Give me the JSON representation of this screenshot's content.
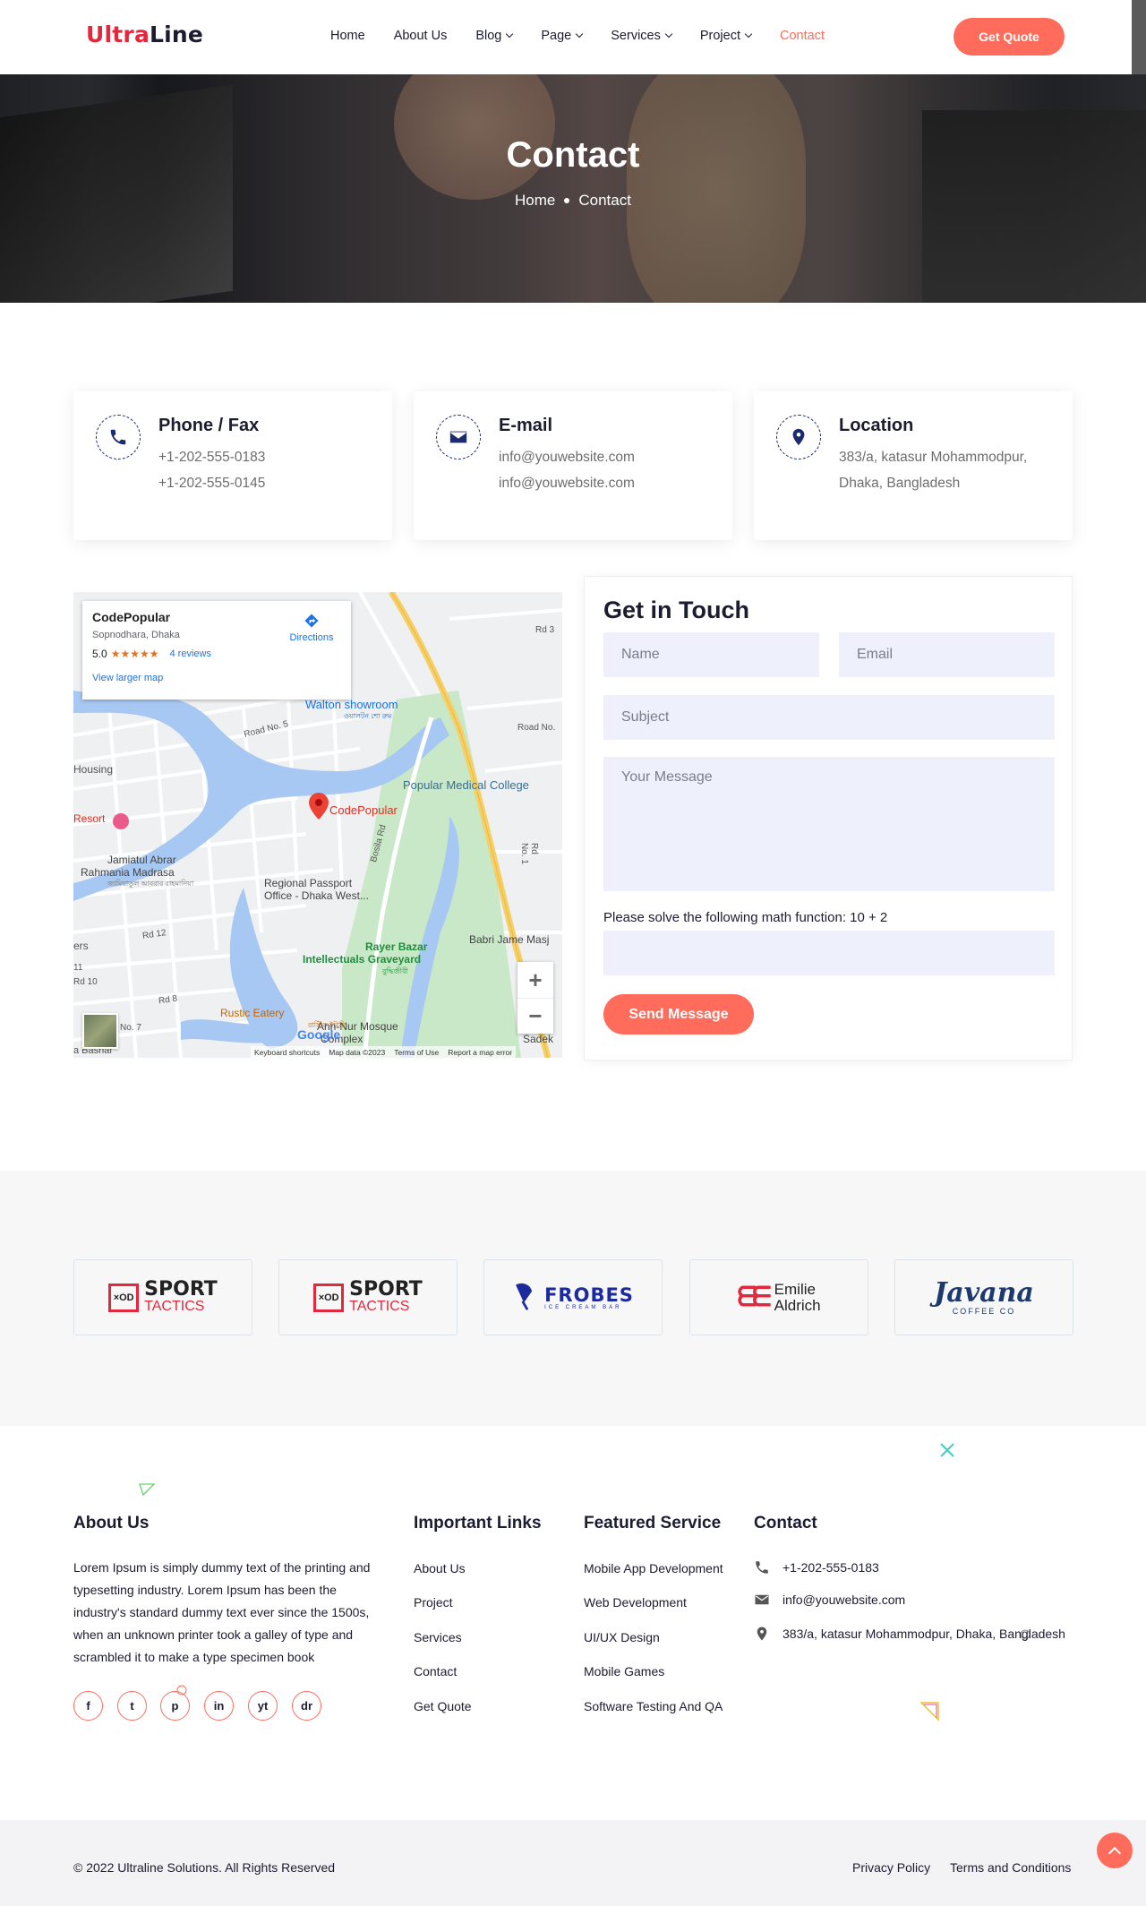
{
  "header": {
    "logo_part1": "Ultra",
    "logo_part2": "Line",
    "nav": [
      {
        "label": "Home",
        "dropdown": false
      },
      {
        "label": "About Us",
        "dropdown": false
      },
      {
        "label": "Blog",
        "dropdown": true
      },
      {
        "label": "Page",
        "dropdown": true
      },
      {
        "label": "Services",
        "dropdown": true
      },
      {
        "label": "Project",
        "dropdown": true
      },
      {
        "label": "Contact",
        "dropdown": false,
        "active": true
      }
    ],
    "quote_button": "Get Quote"
  },
  "hero": {
    "title": "Contact",
    "breadcrumb_home": "Home",
    "breadcrumb_current": "Contact"
  },
  "info_cards": [
    {
      "icon": "phone-icon",
      "title": "Phone / Fax",
      "line1": "+1-202-555-0183",
      "line2": "+1-202-555-0145"
    },
    {
      "icon": "envelope-icon",
      "title": "E-mail",
      "line1": "info@youwebsite.com",
      "line2": "info@youwebsite.com"
    },
    {
      "icon": "map-pin-icon",
      "title": "Location",
      "line1": "383/a, katasur Mohammodpur,",
      "line2": "Dhaka, Bangladesh"
    }
  ],
  "map": {
    "place_name": "CodePopular",
    "place_address": "Sopnodhara, Dhaka",
    "rating": "5.0",
    "stars": "★★★★★",
    "reviews": "4 reviews",
    "view_larger": "View larger map",
    "directions": "Directions",
    "labels": {
      "walton": "Walton showroom",
      "walton_bn": "ওয়ালটন শো রুম",
      "popular_college": "Popular Medical College",
      "codepopular": "CodePopular",
      "resort": "Resort",
      "madrasa1": "Jamiatul Abrar",
      "madrasa2": "Rahmania Madrasa",
      "madrasa_bn": "জামিয়াতুল আবরার রাহমানিয়া",
      "passport1": "Regional Passport",
      "passport2": "Office - Dhaka West...",
      "graveyard1": "Rayer Bazar",
      "graveyard2": "Intellectuals Graveyard",
      "graveyard_bn": "বুদ্ধিজীবী",
      "babri": "Babri Jame Masj",
      "rustic": "Rustic Eatery",
      "rustic_bn": "রাস্টিক ইটারি",
      "mosque1": "Ann-Nur Mosque",
      "mosque2": "Complex",
      "road5": "Road No. 5",
      "road_no": "Road No.",
      "rd3": "Rd 3",
      "rdno1": "Rd No. 1",
      "bosila": "Bosila Rd",
      "rd12": "Rd 12",
      "rd10": "Rd 10",
      "rd8": "Rd 8",
      "no7": "No. 7",
      "housing": "Housing",
      "ers": "ers",
      "bashar": "a Bashar",
      "sadek": "Sadek",
      "eleven": "11",
      "google": "Google"
    },
    "footer_links": [
      "Keyboard shortcuts",
      "Map data ©2023",
      "Terms of Use",
      "Report a map error"
    ],
    "zoom_in": "+",
    "zoom_out": "−"
  },
  "form": {
    "title": "Get in Touch",
    "name_placeholder": "Name",
    "email_placeholder": "Email",
    "subject_placeholder": "Subject",
    "message_placeholder": "Your Message",
    "math_label": "Please solve the following math function: 10 + 2",
    "math_value": "",
    "submit": "Send Message"
  },
  "brands": [
    {
      "name_line1": "SPORT",
      "name_line2": "TACTICS",
      "mark": "×OD"
    },
    {
      "name_line1": "SPORT",
      "name_line2": "TACTICS",
      "mark": "×OD"
    },
    {
      "name_line1": "FROBES",
      "name_line2": "ICE CREAM BAR"
    },
    {
      "name_line1": "Emilie",
      "name_line2": "Aldrich"
    },
    {
      "name_line1": "Javana",
      "name_line2": "COFFEE CO"
    }
  ],
  "footer": {
    "about_title": "About Us",
    "about_text": "Lorem Ipsum is simply dummy text of the printing and typesetting industry. Lorem Ipsum has been the industry's standard dummy text ever since the 1500s, when an unknown printer took a galley of type and scrambled it to make a type specimen book",
    "social": [
      "f",
      "t",
      "p",
      "in",
      "yt",
      "dr"
    ],
    "links_title": "Important Links",
    "links": [
      "About Us",
      "Project",
      "Services",
      "Contact",
      "Get Quote"
    ],
    "service_title": "Featured Service",
    "services": [
      "Mobile App Development",
      "Web Development",
      "UI/UX Design",
      "Mobile Games",
      "Software Testing And QA"
    ],
    "contact_title": "Contact",
    "contact_phone": "+1-202-555-0183",
    "contact_email": "info@youwebsite.com",
    "contact_address": "383/a, katasur Mohammodpur, Dhaka, Bangladesh"
  },
  "bottom": {
    "copyright": "2022 Ultraline Solutions. All Rights Reserved",
    "privacy": "Privacy Policy",
    "terms": "Terms and Conditions"
  },
  "colors": {
    "accent": "#ff6c5c",
    "navy": "#1c2a6e",
    "logo_red": "#e3283e",
    "text": "#1c1c30"
  }
}
